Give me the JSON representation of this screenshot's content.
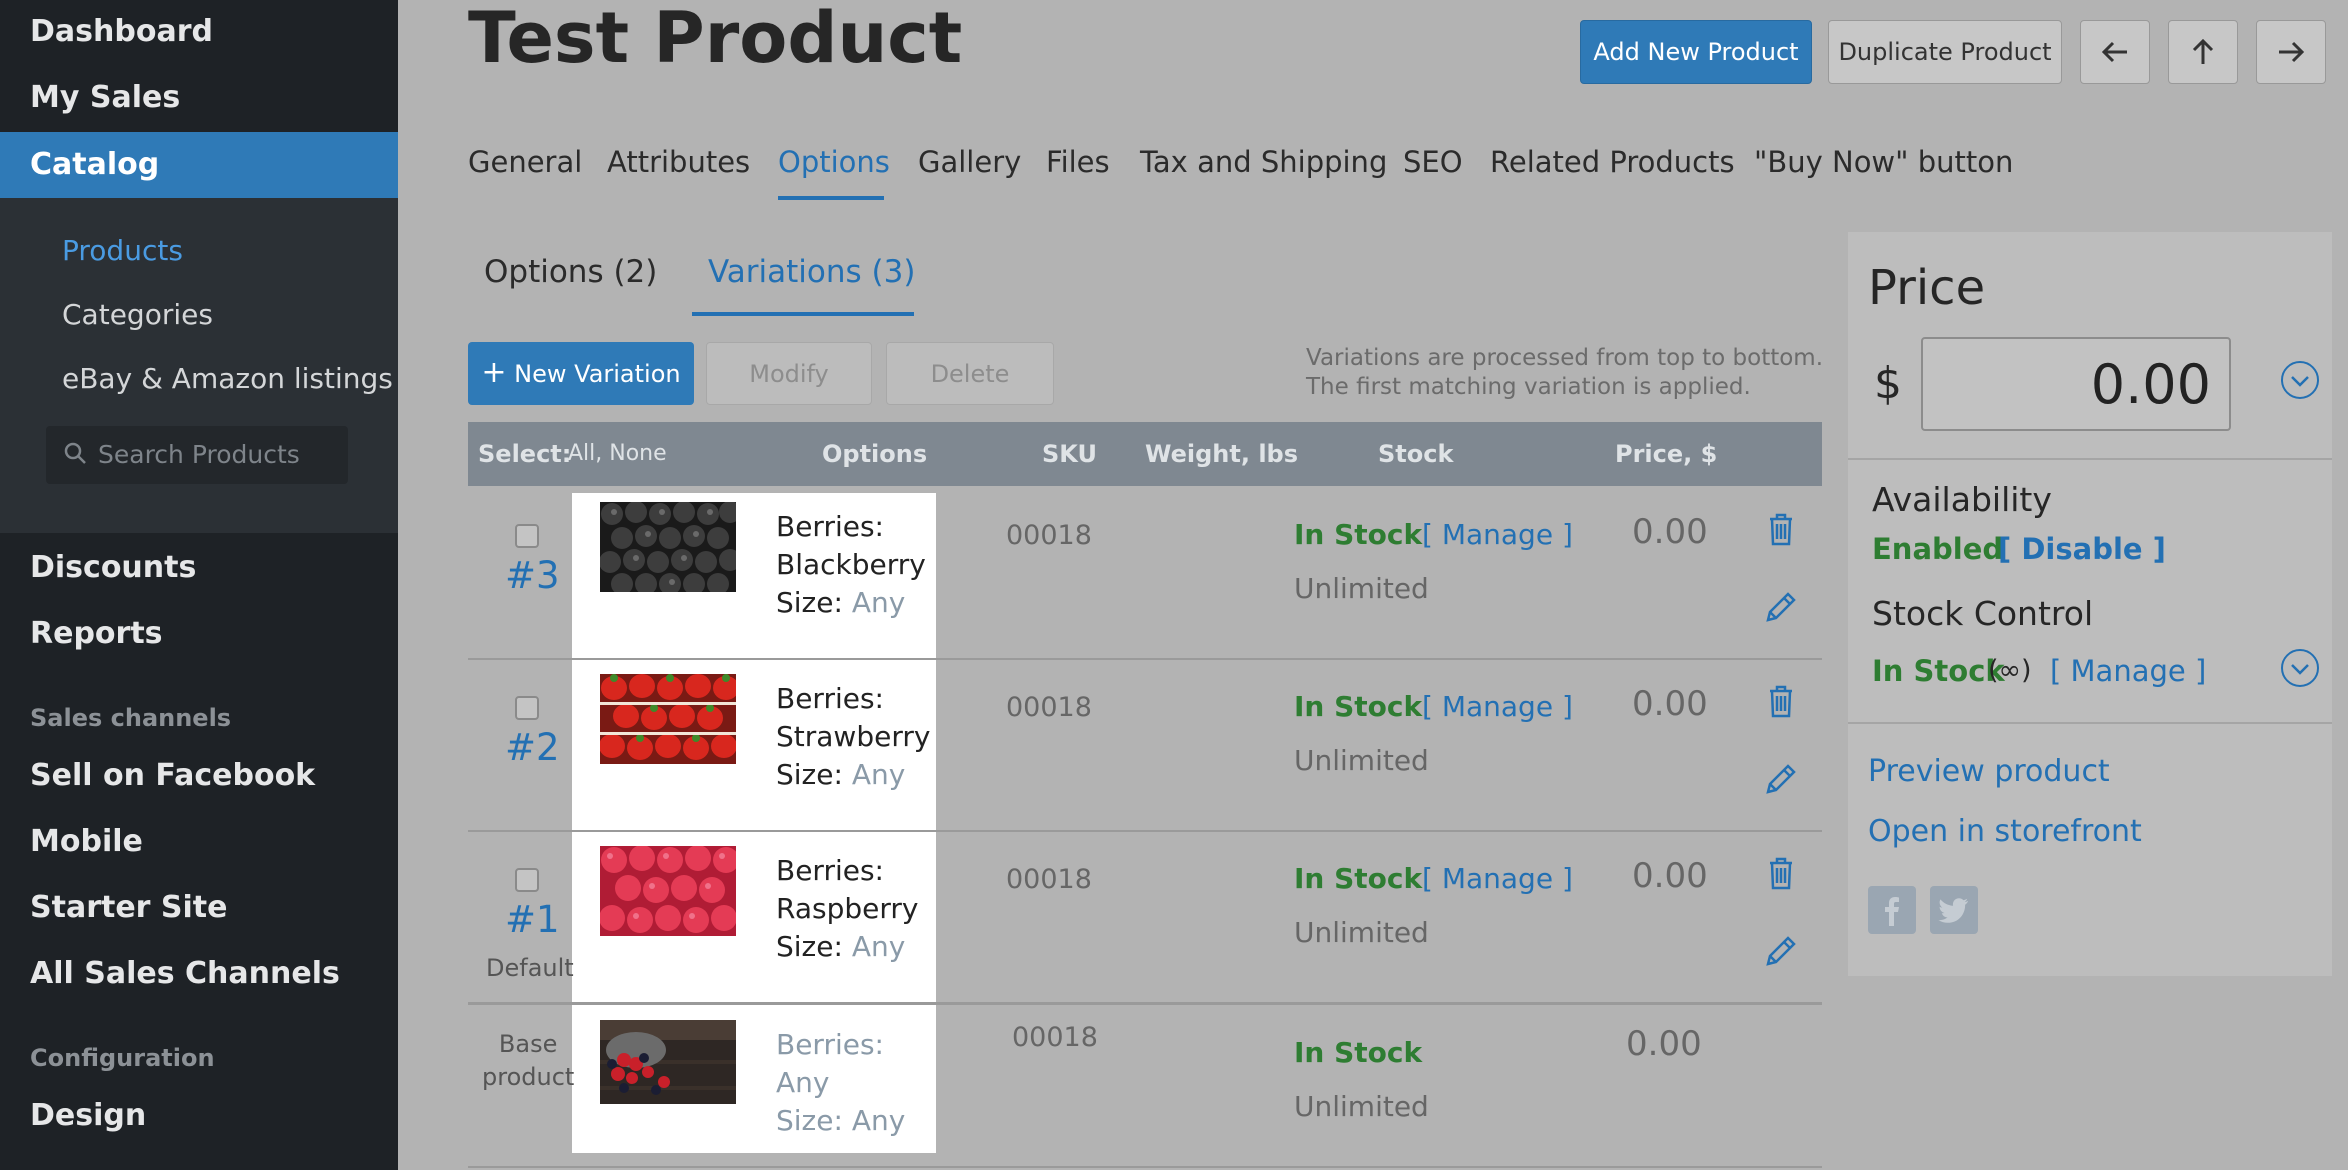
{
  "sidebar": {
    "items": [
      {
        "label": "Dashboard"
      },
      {
        "label": "My Sales"
      },
      {
        "label": "Catalog"
      },
      {
        "label": "Discounts"
      },
      {
        "label": "Reports"
      },
      {
        "label": "Sell on Facebook"
      },
      {
        "label": "Mobile"
      },
      {
        "label": "Starter Site"
      },
      {
        "label": "All Sales Channels"
      },
      {
        "label": "Design"
      }
    ],
    "catalog_sub": [
      {
        "label": "Products"
      },
      {
        "label": "Categories"
      },
      {
        "label": "eBay & Amazon listings"
      }
    ],
    "search_placeholder": "Search Products",
    "section_sales_channels": "Sales channels",
    "section_configuration": "Configuration"
  },
  "header": {
    "title": "Test Product",
    "add_new": "Add New Product",
    "duplicate": "Duplicate Product"
  },
  "tabs": [
    "General",
    "Attributes",
    "Options",
    "Gallery",
    "Files",
    "Tax and Shipping",
    "SEO",
    "Related Products",
    "\"Buy Now\" button"
  ],
  "subtabs": [
    "Options (2)",
    "Variations (3)"
  ],
  "toolbar": {
    "new_variation": "New Variation",
    "modify": "Modify",
    "delete": "Delete",
    "note_line1": "Variations are processed from top to bottom.",
    "note_line2": "The first matching variation is applied."
  },
  "table": {
    "select_label": "Select:",
    "select_links": "All, None",
    "headers": {
      "options": "Options",
      "sku": "SKU",
      "weight": "Weight, lbs",
      "stock": "Stock",
      "price": "Price, $"
    },
    "rows": [
      {
        "num": "#3",
        "sub": "",
        "opt_name": "Berries:",
        "opt_value": "Blackberry",
        "size_label": "Size:",
        "size_value": "Any",
        "sku": "00018",
        "stock": "In Stock",
        "manage": "[ Manage ]",
        "unlimited": "Unlimited",
        "price": "0.00"
      },
      {
        "num": "#2",
        "sub": "",
        "opt_name": "Berries:",
        "opt_value": "Strawberry",
        "size_label": "Size:",
        "size_value": "Any",
        "sku": "00018",
        "stock": "In Stock",
        "manage": "[ Manage ]",
        "unlimited": "Unlimited",
        "price": "0.00"
      },
      {
        "num": "#1",
        "sub": "Default",
        "opt_name": "Berries:",
        "opt_value": "Raspberry",
        "size_label": "Size:",
        "size_value": "Any",
        "sku": "00018",
        "stock": "In Stock",
        "manage": "[ Manage ]",
        "unlimited": "Unlimited",
        "price": "0.00"
      }
    ],
    "base": {
      "label_line1": "Base",
      "label_line2": "product",
      "opt_name": "Berries:",
      "opt_value": "Any",
      "size_label": "Size:",
      "size_value": "Any",
      "sku": "00018",
      "stock": "In Stock",
      "unlimited": "Unlimited",
      "price": "0.00"
    }
  },
  "right_panel": {
    "price_title": "Price",
    "currency": "$",
    "price_value": "0.00",
    "availability_label": "Availability",
    "availability_status": "Enabled",
    "availability_action": "[ Disable ]",
    "stock_control_label": "Stock Control",
    "stock_status": "In Stock",
    "stock_infinite": "(∞)",
    "stock_manage": "[ Manage ]",
    "preview": "Preview product",
    "open_storefront": "Open in storefront"
  }
}
